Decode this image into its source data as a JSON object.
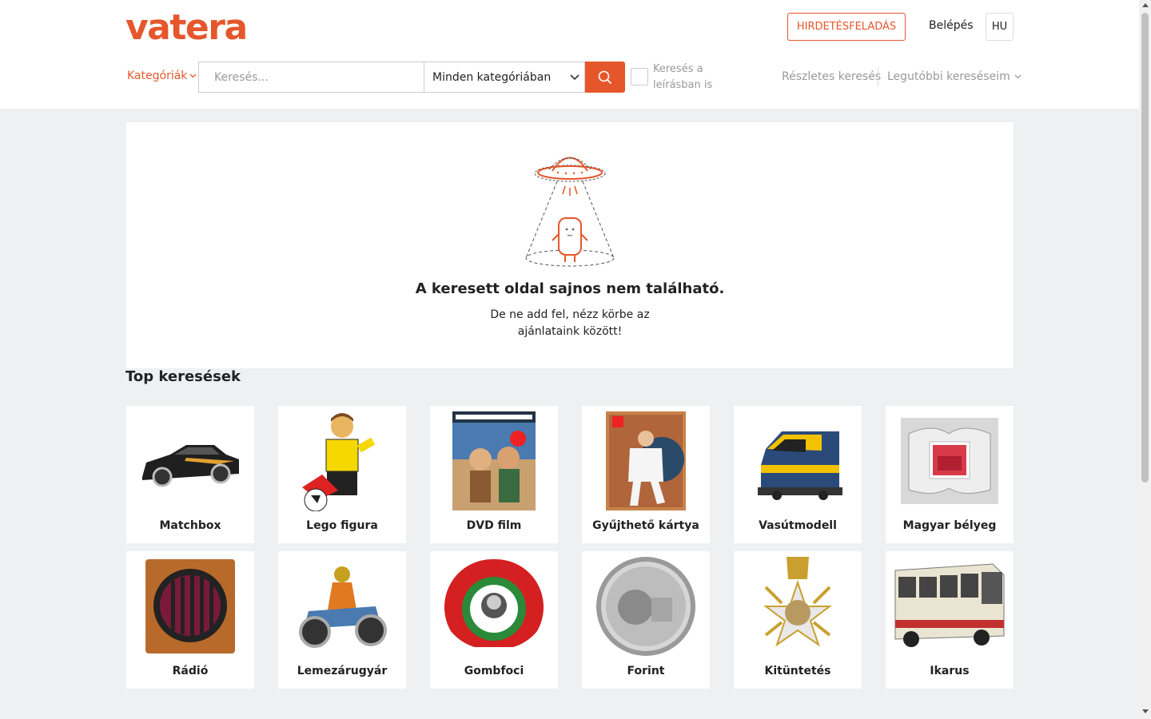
{
  "header": {
    "logo": "vatera",
    "post_ad": "HIRDETÉSFELADÁS",
    "login": "Belépés",
    "language": "HU"
  },
  "search": {
    "categories_label": "Kategóriák",
    "placeholder": "Keresés...",
    "category_select": "Minden kategóriában",
    "desc_label": "Keresés a leírásban is",
    "advanced": "Részletes keresés",
    "recent": "Legutóbbi kereséseim"
  },
  "notfound": {
    "title": "A keresett oldal sajnos nem található.",
    "subtitle": "De ne add fel, nézz körbe az ajánlataink között!"
  },
  "top_searches": {
    "title": "Top keresések",
    "items": [
      {
        "label": "Matchbox",
        "icon": "toy-car-image"
      },
      {
        "label": "Lego figura",
        "icon": "lego-figure-image"
      },
      {
        "label": "DVD film",
        "icon": "dvd-cover-image"
      },
      {
        "label": "Gyűjthető kártya",
        "icon": "trading-card-image"
      },
      {
        "label": "Vasútmodell",
        "icon": "model-train-image"
      },
      {
        "label": "Magyar bélyeg",
        "icon": "stamp-image"
      },
      {
        "label": "Rádió",
        "icon": "radio-image"
      },
      {
        "label": "Lemezárugyár",
        "icon": "tin-motorcycle-image"
      },
      {
        "label": "Gombfoci",
        "icon": "button-football-image"
      },
      {
        "label": "Forint",
        "icon": "coin-image"
      },
      {
        "label": "Kitüntetés",
        "icon": "medal-image"
      },
      {
        "label": "Ikarus",
        "icon": "bus-image"
      }
    ]
  },
  "colors": {
    "brand": "#e5572b",
    "background": "#eef0f2"
  }
}
